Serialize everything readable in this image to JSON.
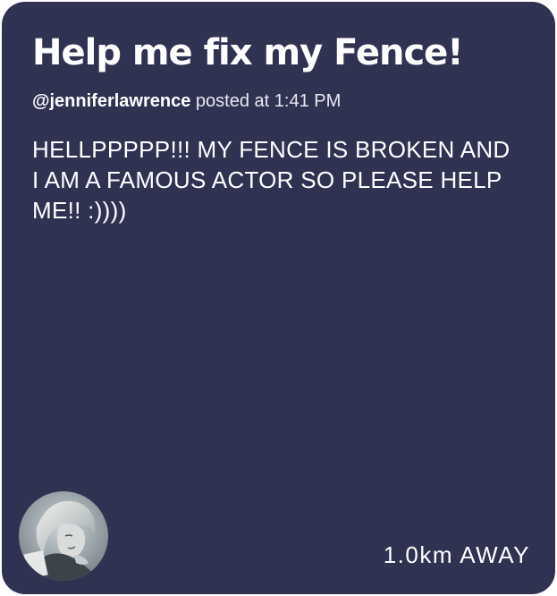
{
  "post": {
    "title": "Help me fix my Fence!",
    "author_handle": "@jenniferlawrence",
    "posted_prefix": "posted at",
    "posted_time": "1:41 PM",
    "body": "HELLPPPPP!!! MY FENCE IS BROKEN AND I AM A FAMOUS ACTOR SO PLEASE HELP ME!! :))))",
    "distance": "1.0km AWAY"
  },
  "avatar": {
    "icon": "user-avatar-photo"
  },
  "colors": {
    "card_background": "#303252",
    "text": "#ffffff",
    "page_background": "#ffffff"
  }
}
